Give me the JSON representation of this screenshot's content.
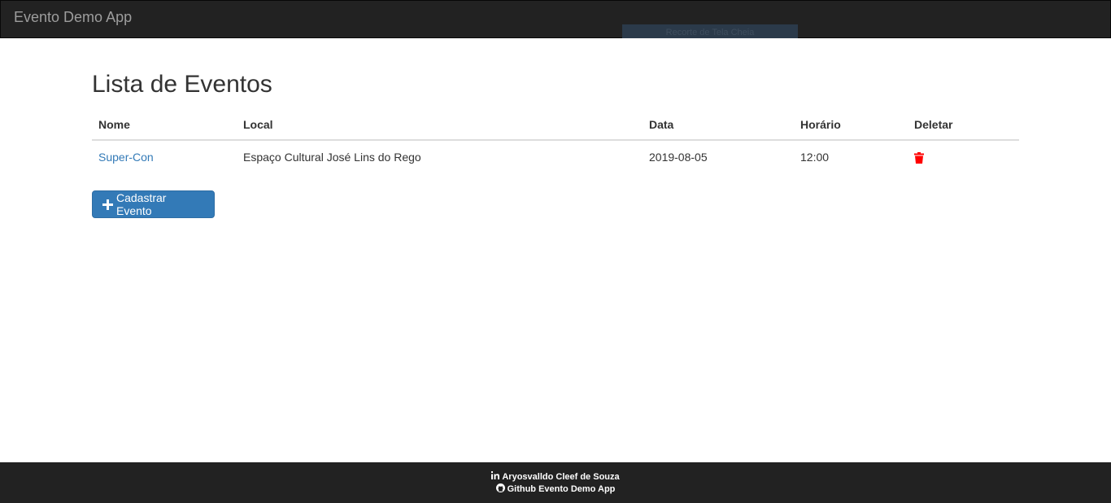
{
  "navbar": {
    "brand": "Evento Demo App",
    "overlay_label": "Recorte de Tela Cheia"
  },
  "main": {
    "title": "Lista de Eventos",
    "table": {
      "headers": [
        "Nome",
        "Local",
        "Data",
        "Horário",
        "Deletar"
      ],
      "rows": [
        {
          "nome": "Super-Con",
          "local": "Espaço Cultural José Lins do Rego",
          "data": "2019-08-05",
          "horario": "12:00",
          "delete_icon": "trash-icon"
        }
      ]
    },
    "add_button_label": "Cadastrar Evento",
    "add_button_icon": "plus-icon"
  },
  "footer": {
    "author": "Aryosvalldo Cleef de Souza",
    "author_icon": "linkedin-icon",
    "repo": "Github Evento Demo App",
    "repo_icon": "github-icon"
  },
  "colors": {
    "navbar_bg": "#222222",
    "link": "#337ab7",
    "primary_button": "#337ab7",
    "delete_icon": "#ff0000"
  }
}
